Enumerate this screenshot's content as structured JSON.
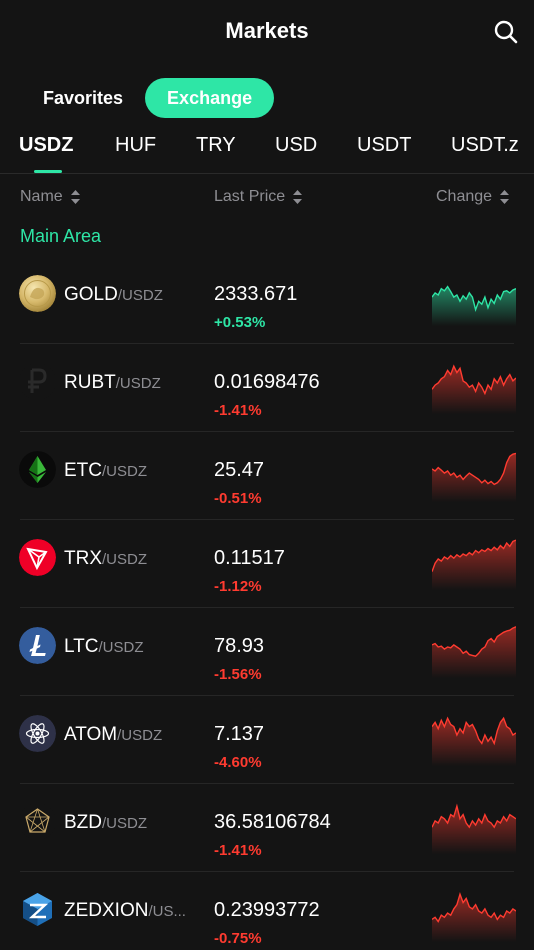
{
  "header": {
    "title": "Markets",
    "search_icon": "search-icon"
  },
  "segments": [
    {
      "label": "Favorites",
      "active": false
    },
    {
      "label": "Exchange",
      "active": true
    }
  ],
  "quote_tabs": [
    "USDZ",
    "HUF",
    "TRY",
    "USD",
    "USDT",
    "USDT.z"
  ],
  "active_quote_tab": "USDZ",
  "columns": {
    "name": "Name",
    "last_price": "Last Price",
    "change": "Change"
  },
  "section_label": "Main Area",
  "colors": {
    "accent": "#2ee6a6",
    "up": "#2ee6a6",
    "down": "#ff3b30",
    "background": "#141414"
  },
  "rows": [
    {
      "base": "GOLD",
      "quote": "/USDZ",
      "price": "2333.671",
      "change": "+0.53%",
      "direction": "up",
      "icon": "gold-coin-icon",
      "spark": [
        0.55,
        0.45,
        0.5,
        0.35,
        0.4,
        0.3,
        0.42,
        0.55,
        0.5,
        0.65,
        0.52,
        0.6,
        0.45,
        0.55,
        0.85,
        0.65,
        0.72,
        0.55,
        0.8,
        0.6,
        0.7,
        0.5,
        0.6,
        0.42,
        0.4,
        0.45,
        0.38,
        0.35
      ]
    },
    {
      "base": "RUBT",
      "quote": "/USDZ",
      "price": "0.01698476",
      "change": "-1.41%",
      "direction": "down",
      "icon": "ruble-icon",
      "spark": [
        0.65,
        0.55,
        0.5,
        0.4,
        0.35,
        0.2,
        0.3,
        0.1,
        0.25,
        0.15,
        0.45,
        0.5,
        0.6,
        0.55,
        0.7,
        0.5,
        0.6,
        0.75,
        0.55,
        0.65,
        0.4,
        0.5,
        0.35,
        0.55,
        0.4,
        0.3,
        0.45,
        0.38
      ]
    },
    {
      "base": "ETC",
      "quote": "/USDZ",
      "price": "25.47",
      "change": "-0.51%",
      "direction": "down",
      "icon": "ethereum-classic-icon",
      "spark": [
        0.45,
        0.5,
        0.42,
        0.48,
        0.55,
        0.5,
        0.6,
        0.55,
        0.65,
        0.6,
        0.7,
        0.62,
        0.55,
        0.6,
        0.65,
        0.7,
        0.78,
        0.72,
        0.8,
        0.75,
        0.82,
        0.78,
        0.7,
        0.55,
        0.3,
        0.15,
        0.1,
        0.08
      ]
    },
    {
      "base": "TRX",
      "quote": "/USDZ",
      "price": "0.11517",
      "change": "-1.12%",
      "direction": "down",
      "icon": "tron-icon",
      "spark": [
        0.8,
        0.6,
        0.5,
        0.55,
        0.45,
        0.5,
        0.42,
        0.48,
        0.4,
        0.45,
        0.38,
        0.42,
        0.35,
        0.4,
        0.3,
        0.35,
        0.28,
        0.32,
        0.25,
        0.3,
        0.22,
        0.28,
        0.18,
        0.25,
        0.12,
        0.2,
        0.08,
        0.05
      ]
    },
    {
      "base": "LTC",
      "quote": "/USDZ",
      "price": "78.93",
      "change": "-1.56%",
      "direction": "down",
      "icon": "litecoin-icon",
      "spark": [
        0.45,
        0.42,
        0.5,
        0.48,
        0.55,
        0.5,
        0.52,
        0.45,
        0.5,
        0.55,
        0.65,
        0.6,
        0.68,
        0.7,
        0.72,
        0.65,
        0.55,
        0.5,
        0.35,
        0.3,
        0.38,
        0.25,
        0.2,
        0.15,
        0.12,
        0.1,
        0.05,
        0.02
      ]
    },
    {
      "base": "ATOM",
      "quote": "/USDZ",
      "price": "7.137",
      "change": "-4.60%",
      "direction": "down",
      "icon": "cosmos-icon",
      "spark": [
        0.3,
        0.2,
        0.35,
        0.15,
        0.3,
        0.1,
        0.25,
        0.3,
        0.5,
        0.35,
        0.45,
        0.2,
        0.3,
        0.25,
        0.4,
        0.6,
        0.7,
        0.5,
        0.65,
        0.55,
        0.7,
        0.4,
        0.2,
        0.1,
        0.3,
        0.35,
        0.5,
        0.45
      ]
    },
    {
      "base": "BZD",
      "quote": "/USDZ",
      "price": "36.58106784",
      "change": "-1.41%",
      "direction": "down",
      "icon": "bzd-icon",
      "spark": [
        0.6,
        0.45,
        0.5,
        0.35,
        0.4,
        0.5,
        0.3,
        0.35,
        0.1,
        0.4,
        0.3,
        0.5,
        0.6,
        0.45,
        0.55,
        0.4,
        0.5,
        0.3,
        0.45,
        0.5,
        0.6,
        0.45,
        0.5,
        0.35,
        0.45,
        0.3,
        0.35,
        0.4
      ]
    },
    {
      "base": "ZEDXION",
      "quote": "/US...",
      "price": "0.23993772",
      "change": "-0.75%",
      "direction": "down",
      "icon": "zedxion-icon",
      "spark": [
        0.7,
        0.65,
        0.75,
        0.6,
        0.65,
        0.55,
        0.6,
        0.45,
        0.35,
        0.1,
        0.3,
        0.2,
        0.4,
        0.45,
        0.35,
        0.5,
        0.55,
        0.45,
        0.6,
        0.65,
        0.55,
        0.7,
        0.6,
        0.65,
        0.5,
        0.55,
        0.45,
        0.5
      ]
    }
  ]
}
